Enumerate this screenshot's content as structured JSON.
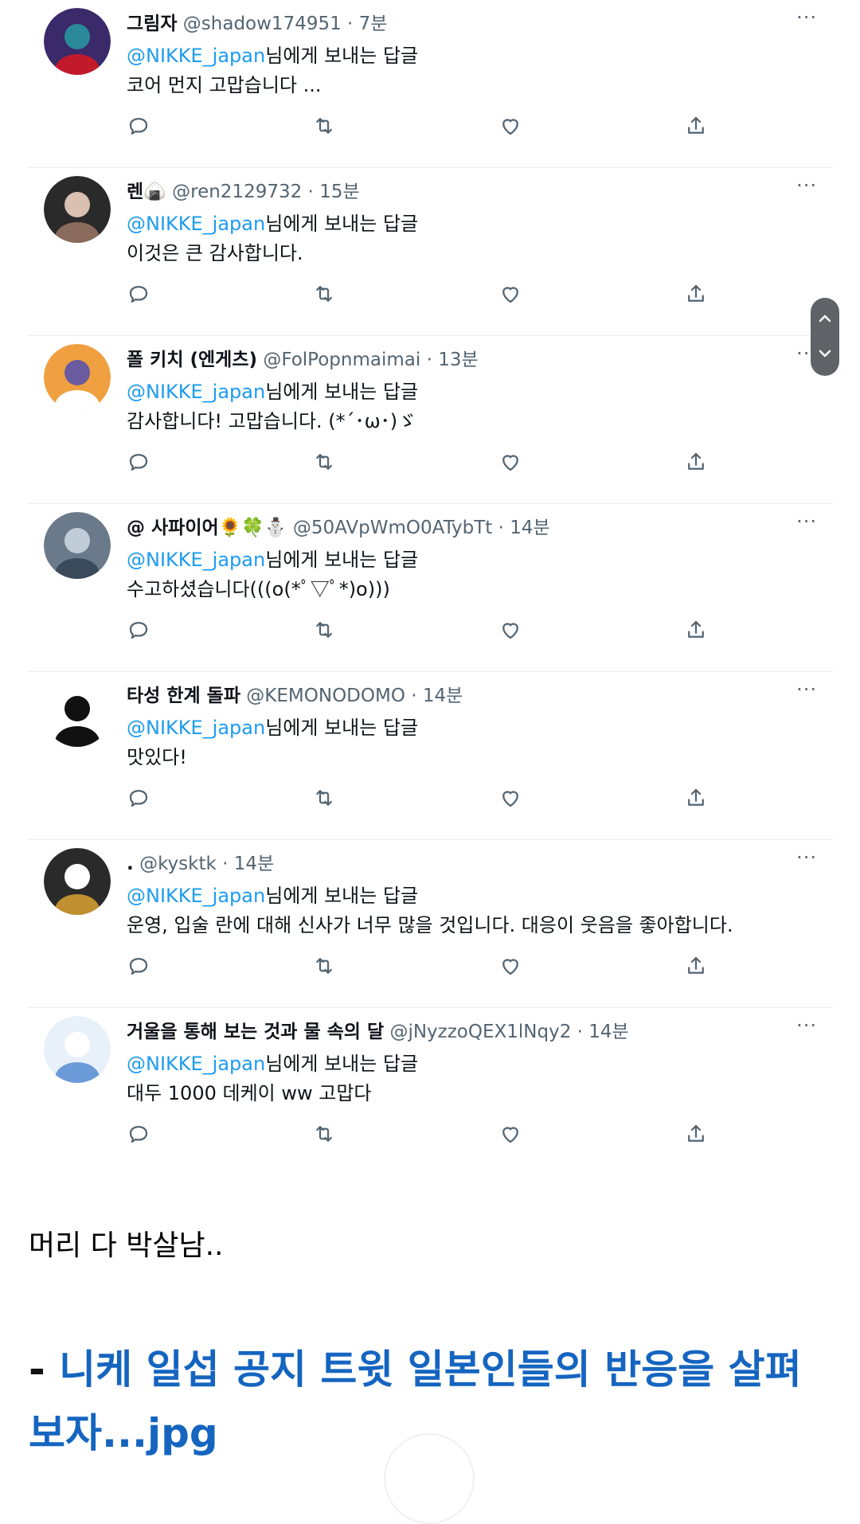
{
  "reply_prefix": "님에게 보내는 답글",
  "more_label": "···",
  "tweets": [
    {
      "name": "그림자",
      "handle": "@shadow174951",
      "time": "7분",
      "mention": "@NIKKE_japan",
      "text": "코어 먼지 고맙습니다 ...",
      "avatar_colors": [
        "#3a2a6a",
        "#c21a2a",
        "#2a8a9a"
      ]
    },
    {
      "name": "렌🍙",
      "handle": "@ren2129732",
      "time": "15분",
      "mention": "@NIKKE_japan",
      "text": "이것은 큰 감사합니다.",
      "avatar_colors": [
        "#2a2a2a",
        "#8a6a5a",
        "#d9c0b0"
      ]
    },
    {
      "name": "폴 키치 (엔게츠)",
      "handle": "@FolPopnmaimai",
      "time": "13분",
      "mention": "@NIKKE_japan",
      "text": "감사합니다! 고맙습니다. (*´･ω･)ゞ",
      "avatar_colors": [
        "#f0a040",
        "#ffffff",
        "#6a5aa0"
      ]
    },
    {
      "name": "@ 사파이어🌻🍀⛄",
      "handle": "@50AVpWmO0ATybTt",
      "time": "14분",
      "mention": "@NIKKE_japan",
      "text": "수고하셨습니다(((o(*ﾟ▽ﾟ*)o)))",
      "avatar_colors": [
        "#6a7a8a",
        "#3a4a5a",
        "#c0ccd8"
      ]
    },
    {
      "name": "타성 한계 돌파",
      "handle": "@KEMONODOMO",
      "time": "14분",
      "mention": "@NIKKE_japan",
      "text": "맛있다!",
      "avatar_colors": [
        "#ffffff",
        "#111111",
        "#111111"
      ]
    },
    {
      "name": ".",
      "handle": "@kysktk",
      "time": "14분",
      "mention": "@NIKKE_japan",
      "text": "운영, 입술 란에 대해 신사가 너무 많을 것입니다. 대응이 웃음을 좋아합니다.",
      "avatar_colors": [
        "#2a2a2a",
        "#c09030",
        "#ffffff"
      ]
    },
    {
      "name": "거울을 통해 보는 것과 물 속의 달",
      "handle": "@jNyzzoQEX1lNqy2",
      "time": "14분",
      "mention": "@NIKKE_japan",
      "text": "대두 1000 데케이 ww 고맙다",
      "avatar_colors": [
        "#e8f0fa",
        "#6a9ad8",
        "#ffffff"
      ]
    }
  ],
  "actions": [
    "reply-icon",
    "retweet-icon",
    "like-icon",
    "share-icon"
  ],
  "caption": "머리 다 박살남..",
  "link": {
    "dash": "- ",
    "text": "니케 일섭 공지 트윗 일본인들의 반응을 살펴보자...jpg"
  },
  "colors": {
    "mention": "#1d9bf0",
    "link": "#1565c0",
    "meta": "#536471"
  }
}
